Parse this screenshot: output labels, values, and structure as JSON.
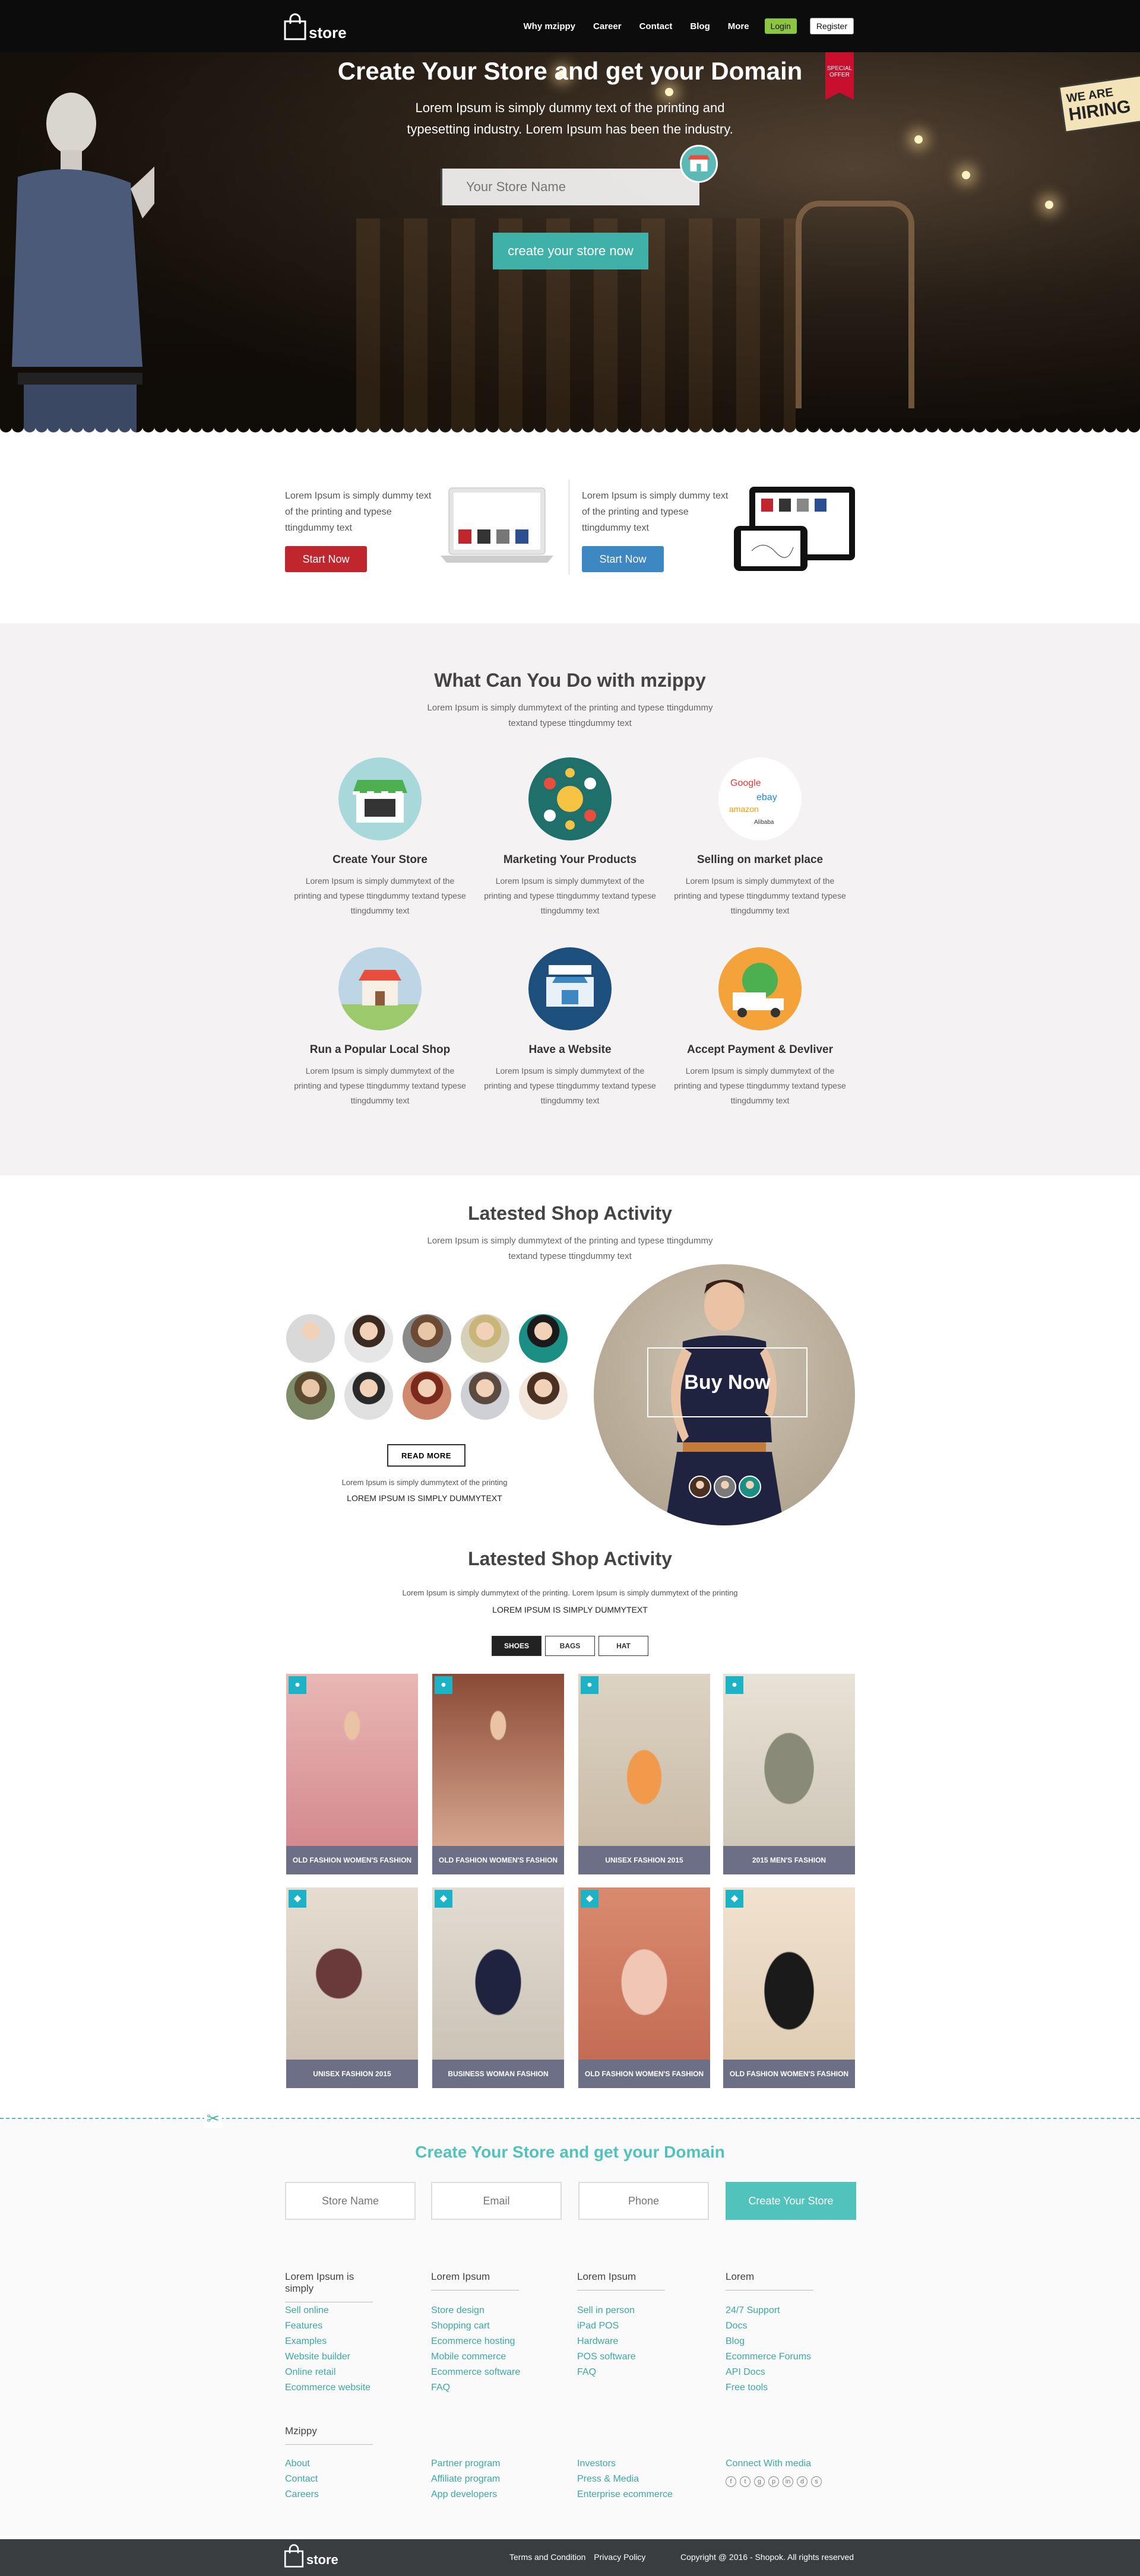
{
  "header": {
    "logo_text": "store",
    "nav": [
      "Why mzippy",
      "Career",
      "Contact",
      "Blog",
      "More"
    ],
    "login": "Login",
    "register": "Register"
  },
  "hero": {
    "title": "Create Your Store and get your Domain",
    "subtitle": "Lorem Ipsum is simply dummy text of the printing and typesetting industry. Lorem Ipsum has been the industry.",
    "input_placeholder": "Your Store Name",
    "cta": "create your store now",
    "ribbon": "SPECIAL OFFER",
    "hiring_small": "WE ARE",
    "hiring_big": "HIRING"
  },
  "promo": [
    {
      "text": "Lorem Ipsum is simply dummy text of the printing and typese ttingdummy text",
      "button": "Start Now",
      "color": "#c0262d"
    },
    {
      "text": "Lorem Ipsum is simply dummy text of the printing and typese ttingdummy text",
      "button": "Start Now",
      "color": "#3d87c2"
    }
  ],
  "what": {
    "title": "What Can You Do with mzippy",
    "subtitle": "Lorem Ipsum is simply dummytext of the printing and typese ttingdummy textand typese ttingdummy text",
    "features": [
      {
        "title": "Create Your Store",
        "desc": "Lorem Ipsum is simply dummytext of the printing and typese ttingdummy textand typese ttingdummy text",
        "icon": "storefront-icon",
        "bg": "#a9d8da"
      },
      {
        "title": "Marketing Your Products",
        "desc": "Lorem Ipsum is simply dummytext of the printing and typese ttingdummy textand typese ttingdummy text",
        "icon": "marketing-icon",
        "bg": "#1f6f6b"
      },
      {
        "title": "Selling on market place",
        "desc": "Lorem Ipsum is simply dummytext of the printing and typese ttingdummy textand typese ttingdummy text",
        "icon": "marketplace-icon",
        "bg": "#ffffff"
      },
      {
        "title": "Run a Popular Local Shop",
        "desc": "Lorem Ipsum is simply dummytext of the printing and typese ttingdummy textand typese ttingdummy text",
        "icon": "local-shop-icon",
        "bg": "#bcd6e6"
      },
      {
        "title": "Have a Website",
        "desc": "Lorem Ipsum is simply dummytext of the printing and typese ttingdummy textand typese ttingdummy text",
        "icon": "website-icon",
        "bg": "#1c4f7c"
      },
      {
        "title": "Accept Payment & Devliver",
        "desc": "Lorem Ipsum is simply dummytext of the printing and typese ttingdummy textand typese ttingdummy text",
        "icon": "payment-delivery-icon",
        "bg": "#f4a23a"
      }
    ]
  },
  "activity": {
    "title": "Latested Shop Activity",
    "subtitle": "Lorem Ipsum is simply dummytext of the printing and typese ttingdummy textand typese ttingdummy text",
    "read_more": "READ MORE",
    "caption1": "Lorem Ipsum is simply dummytext of the printing",
    "caption2": "LOREM IPSUM IS SIMPLY DUMMYTEXT",
    "buy_now": "Buy Now"
  },
  "activity2": {
    "title": "Latested Shop Activity",
    "subtitle": "Lorem Ipsum is simply dummytext of the printing. Lorem Ipsum is simply dummytext of the printing",
    "caption": "LOREM IPSUM IS SIMPLY DUMMYTEXT",
    "tabs": [
      "SHOES",
      "BAGS",
      "HAT"
    ],
    "cards": [
      {
        "caption": "OLD FASHION WOMEN'S FASHION"
      },
      {
        "caption": "OLD FASHION WOMEN'S FASHION"
      },
      {
        "caption": "UNISEX FASHION 2015"
      },
      {
        "caption": "2015 MEN'S FASHION"
      },
      {
        "caption": "UNISEX FASHION 2015"
      },
      {
        "caption": "BUSINESS WOMAN FASHION"
      },
      {
        "caption": "OLD FASHION WOMEN'S FASHION"
      },
      {
        "caption": "OLD FASHION WOMEN'S FASHION"
      }
    ]
  },
  "signup": {
    "title": "Create Your Store and get your Domain",
    "fields": [
      "Store Name",
      "Email",
      "Phone"
    ],
    "button": "Create Your Store"
  },
  "footer": {
    "columns": [
      {
        "heading": "Lorem Ipsum is simply",
        "links": [
          "Sell online",
          "Features",
          "Examples",
          "Website builder",
          "Online retail",
          "Ecommerce website"
        ]
      },
      {
        "heading": "Lorem Ipsum",
        "links": [
          "Store design",
          "Shopping cart",
          "Ecommerce hosting",
          "Mobile commerce",
          "Ecommerce software",
          "FAQ"
        ]
      },
      {
        "heading": "Lorem Ipsum",
        "links": [
          "Sell in person",
          "iPad POS",
          "Hardware",
          "POS software",
          "FAQ"
        ]
      },
      {
        "heading": "Lorem",
        "links": [
          "24/7 Support",
          "Docs",
          "Blog",
          "Ecommerce Forums",
          "API Docs",
          "Free tools"
        ]
      }
    ],
    "mzippy_heading": "Mzippy",
    "mzippy_cols": [
      [
        "About",
        "Contact",
        "Careers"
      ],
      [
        "Partner program",
        "Affiliate program",
        "App developers"
      ],
      [
        "Investors",
        "Press & Media",
        "Enterprise ecommerce"
      ]
    ],
    "connect": "Connect With media",
    "social": [
      "facebook-icon",
      "twitter-icon",
      "google-plus-icon",
      "pinterest-icon",
      "linkedin-icon",
      "dribbble-icon",
      "skype-icon"
    ]
  },
  "bottom": {
    "logo_text": "store",
    "terms": "Terms and Condition",
    "privacy": "Privacy Policy",
    "copyright": "Copyright @ 2016 - Shopok. All rights reserved"
  }
}
